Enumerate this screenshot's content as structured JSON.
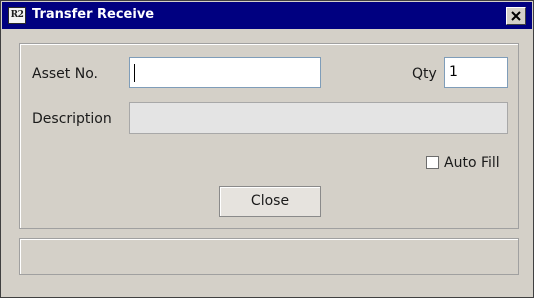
{
  "window": {
    "title": "Transfer Receive",
    "app_icon_text": "R2",
    "icons": {
      "app": "app-icon",
      "close": "close-icon"
    }
  },
  "form": {
    "asset_label": "Asset No.",
    "asset_value": "",
    "qty_label": "Qty",
    "qty_value": "1",
    "description_label": "Description",
    "description_value": "",
    "autofill_label": "Auto Fill",
    "autofill_checked": false,
    "close_label": "Close"
  },
  "statusbar": {
    "text": ""
  },
  "colors": {
    "titlebar": "#000080",
    "surface": "#d4d0c8"
  }
}
